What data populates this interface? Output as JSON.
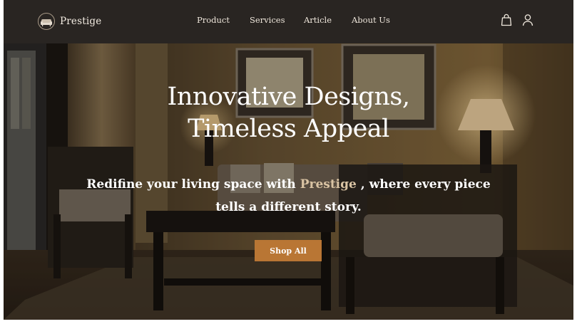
{
  "brand": {
    "name": "Prestige",
    "logo_icon": "sofa-logo-icon"
  },
  "nav": {
    "links": [
      "Product",
      "Services",
      "Article",
      "About Us"
    ],
    "icons": [
      "shopping-bag-icon",
      "user-icon"
    ]
  },
  "hero": {
    "title_line1": "Innovative Designs,",
    "title_line2": "Timeless Appeal",
    "subtitle_part1": "Redifine your living space with ",
    "subtitle_brand": "Prestige",
    "subtitle_part2": " , where every piece",
    "subtitle_line2": "tells a different story.",
    "cta_label": "Shop All"
  },
  "colors": {
    "nav_background": "#292522",
    "accent_button": "#b97634",
    "brand_accent_text": "#d9c3a3"
  }
}
